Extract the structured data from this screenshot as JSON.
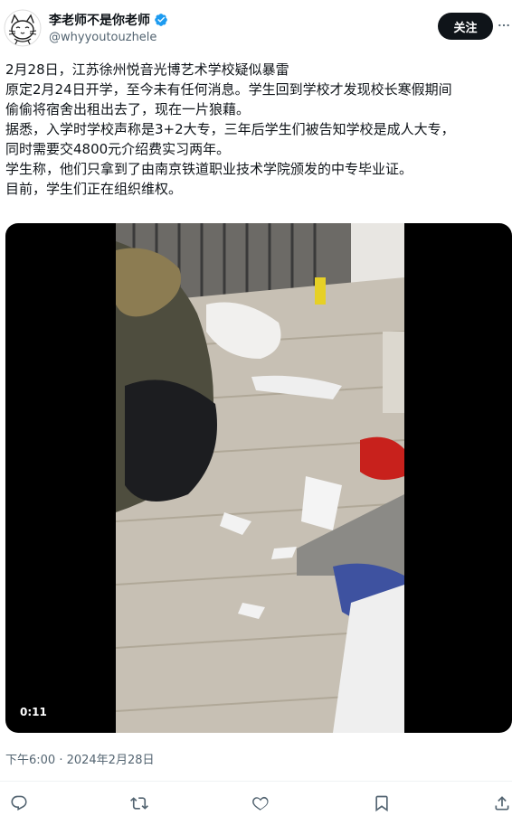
{
  "author": {
    "display_name": "李老师不是你老师",
    "handle": "@whyyoutouzhele",
    "avatar_icon": "cat-doodle-avatar",
    "verified_icon": "verified-badge-icon",
    "verified_color": "#1d9bf0"
  },
  "header": {
    "follow_label": "关注",
    "more_icon": "more-options-icon"
  },
  "tweet": {
    "lines": [
      "2月28日，江苏徐州悦音光博艺术学校疑似暴雷",
      "原定2月24日开学，至今未有任何消息。学生回到学校才发现校长寒假期间",
      "偷偷将宿舍出租出去了，现在一片狼藉。",
      "据悉，入学时学校声称是3+2大专，三年后学生们被告知学校是成人大专，",
      "同时需要交4800元介绍费实习两年。",
      "学生称，他们只拿到了由南京铁道职业技术学院颁发的中专毕业证。",
      "目前，学生们正在组织维权。"
    ]
  },
  "media": {
    "duration": "0:11"
  },
  "timestamp": "下午6:00 · 2024年2月28日",
  "actions": [
    {
      "name": "reply",
      "icon": "reply-icon"
    },
    {
      "name": "retweet",
      "icon": "retweet-icon"
    },
    {
      "name": "like",
      "icon": "like-icon"
    },
    {
      "name": "bookmark",
      "icon": "bookmark-icon"
    },
    {
      "name": "share",
      "icon": "share-icon"
    }
  ],
  "colors": {
    "text_primary": "#0f1419",
    "text_secondary": "#536471",
    "follow_bg": "#0f1419",
    "divider": "#eff3f4"
  }
}
